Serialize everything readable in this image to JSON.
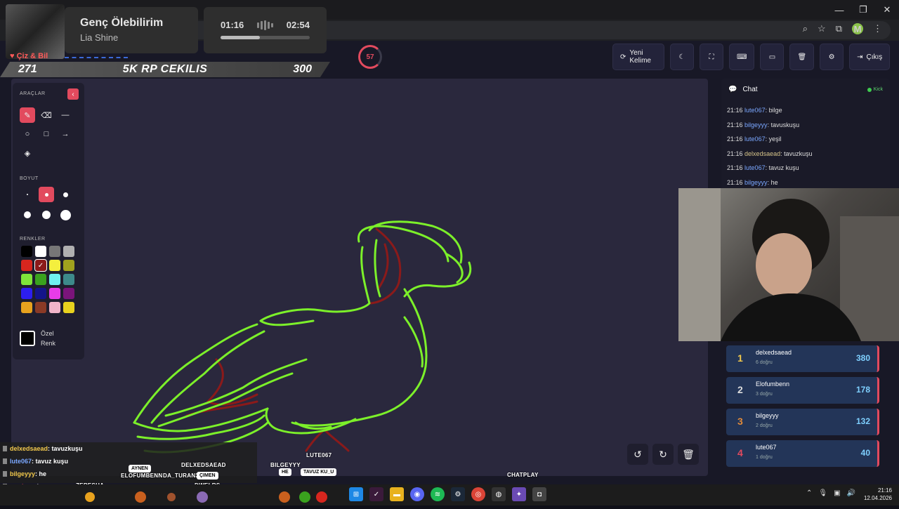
{
  "browser": {
    "profile_initial": "M"
  },
  "music": {
    "title": "Genç Ölebilirim",
    "artist": "Lia Shine",
    "current_time": "01:16",
    "total_time": "02:54",
    "progress": 0.44
  },
  "overlay": {
    "app_label": "Çiz & Bil",
    "left_count": "271",
    "banner": "5K RP CEKILIS",
    "right_count": "300"
  },
  "timer": {
    "value": "57"
  },
  "toolbar": {
    "new_word": "Yeni Kelime",
    "exit": "Çıkış"
  },
  "tools": {
    "tools_title": "ARAÇLAR",
    "size_title": "BOYUT",
    "colors_title": "RENKLER",
    "custom_color_line1": "Özel",
    "custom_color_line2": "Renk",
    "colors": [
      "#000000",
      "#ffffff",
      "#777777",
      "#b0b0b0",
      "#d7261e",
      "#8b1a1a",
      "#f4ef3e",
      "#a0a21e",
      "#7fe53a",
      "#3aa21e",
      "#6ff0f0",
      "#3d8a8a",
      "#2d1ef0",
      "#14148a",
      "#e83ce8",
      "#7a147a",
      "#e8a21e",
      "#8a3a26",
      "#f0b4c8",
      "#e8d21e"
    ],
    "selected_color": "#8b1a1a"
  },
  "chat": {
    "title": "Chat",
    "platform": "Kick",
    "messages": [
      {
        "time": "21:16",
        "user": "lute067",
        "color": "#7aa7ff",
        "text": ": bilge"
      },
      {
        "time": "21:16",
        "user": "bilgeyyy",
        "color": "#7aa7ff",
        "text": ": tavuskuşu"
      },
      {
        "time": "21:16",
        "user": "lute067",
        "color": "#7aa7ff",
        "text": ": yeşil"
      },
      {
        "time": "21:16",
        "user": "delxedsaead",
        "color": "#d6c48a",
        "text": ": tavuzkuşu"
      },
      {
        "time": "21:16",
        "user": "lute067",
        "color": "#7aa7ff",
        "text": ": tavuz kuşu"
      },
      {
        "time": "21:16",
        "user": "bilgeyyy",
        "color": "#7aa7ff",
        "text": ": he"
      }
    ]
  },
  "leaderboard": [
    {
      "rank": "1",
      "name": "delxedsaead",
      "correct": "6 doğru",
      "score": "380",
      "rank_color": "#f2c94c"
    },
    {
      "rank": "2",
      "name": "Elofumbenn",
      "correct": "3 doğru",
      "score": "178",
      "rank_color": "#dddddd"
    },
    {
      "rank": "3",
      "name": "bilgeyyy",
      "correct": "2 doğru",
      "score": "132",
      "rank_color": "#e08a3a"
    },
    {
      "rank": "4",
      "name": "lute067",
      "correct": "1 doğru",
      "score": "40",
      "rank_color": "#e24a5e"
    }
  ],
  "stream_chat": [
    {
      "user": "delxedsaead",
      "text": " : tavuzkuşu",
      "color": "#f2c94c"
    },
    {
      "user": "lute067",
      "text": " : tavuz kuşu",
      "color": "#7aa7ff"
    },
    {
      "user": "bilgeyyy",
      "text": " : he",
      "color": "#f2c94c"
    },
    {
      "user": "awelrs",
      "text": " : çimen",
      "color": "#ff4a4a"
    }
  ],
  "chatplay": {
    "label": "CHATPLAY",
    "names": [
      "ZERESHA",
      "ELOFUMBENN",
      "DA_TURAN3",
      "DELXEDSAEAD",
      "DWELRS",
      "BILGEYYY",
      "LUTE067"
    ],
    "bubbles": [
      "AYNEN",
      "ÇIMEN",
      "HE",
      "TAVUZ KU_U"
    ]
  },
  "taskbar": {
    "time": "21:16",
    "date": "12.04.2026"
  }
}
